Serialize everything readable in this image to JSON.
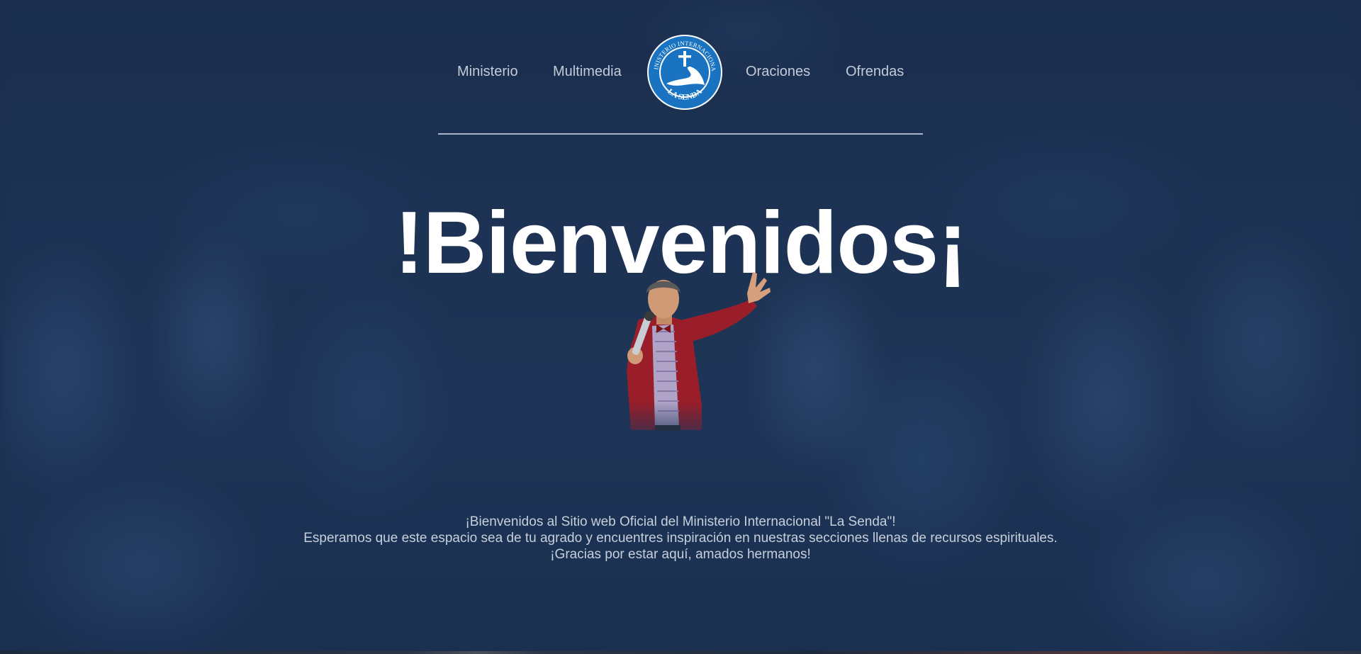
{
  "nav": {
    "items": [
      {
        "label": "Ministerio"
      },
      {
        "label": "Multimedia"
      },
      {
        "label": "Oraciones"
      },
      {
        "label": "Ofrendas"
      }
    ],
    "logo": {
      "ring_text": "MINISTERIO INTERNACIONAL",
      "name": "LA SENDA"
    }
  },
  "hero": {
    "title": "!Bienvenidos¡"
  },
  "welcome": {
    "lines": [
      "¡Bienvenidos al Sitio web Oficial del Ministerio Internacional \"La Senda\"!",
      "Esperamos que este espacio sea de tu agrado y encuentres inspiración en nuestras secciones llenas de recursos espirituales.",
      "¡Gracias por estar aquí, amados hermanos!"
    ]
  },
  "colors": {
    "background": "#1f3253",
    "logo_blue": "#1a73c0",
    "jacket_red": "#9a1e2a"
  }
}
